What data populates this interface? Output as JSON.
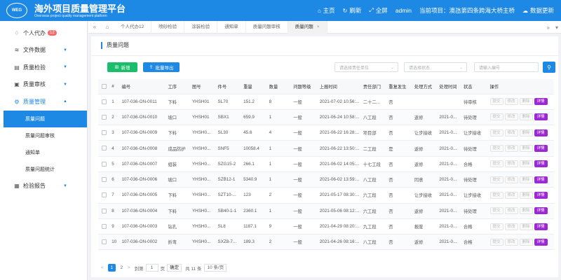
{
  "header": {
    "logo_text": "WEG",
    "title": "海外项目质量管理平台",
    "subtitle": "Overseas project quality management platform",
    "nav": [
      {
        "icon": "home-icon",
        "glyph": "⌂",
        "label": "主页"
      },
      {
        "icon": "refresh-icon",
        "glyph": "↻",
        "label": "刷新"
      },
      {
        "icon": "fullscreen-icon",
        "glyph": "⤢",
        "label": "全屏"
      },
      {
        "icon": "",
        "glyph": "",
        "label": "admin"
      },
      {
        "icon": "",
        "glyph": "",
        "label": "当前项目：澳氹第四条跨海大桥主桥"
      },
      {
        "icon": "cloud-update-icon",
        "glyph": "☁",
        "label": "数据更新"
      }
    ]
  },
  "sidebar": {
    "items": [
      {
        "label": "个人代办",
        "badge": "12"
      },
      {
        "label": "文件数据"
      },
      {
        "label": "质量检验"
      },
      {
        "label": "质量审核"
      },
      {
        "label": "质量管理"
      },
      {
        "label": "检验报告"
      }
    ],
    "sub_items": [
      "质量问题",
      "质量问题审核",
      "通知单",
      "质量问题统计"
    ]
  },
  "tabs": {
    "items": [
      "个人代办12",
      "喷砂检验",
      "涂装检验",
      "通知单",
      "质量问题审核",
      "质量问题"
    ]
  },
  "page": {
    "title": "质量问题",
    "add_label": "新增",
    "export_label": "批量导出",
    "filter_unit_placeholder": "请选择责任单位",
    "filter_status_placeholder": "请选择状态",
    "filter_code_placeholder": "请输入编号"
  },
  "table": {
    "columns": [
      "",
      "#",
      "编号",
      "工序",
      "图号",
      "件号",
      "重量",
      "数量",
      "问题等级",
      "上报时间",
      "责任部门",
      "重复发生",
      "处理方式",
      "处理时间",
      "状态",
      "操作"
    ],
    "op_labels": {
      "submit": "提交",
      "edit": "修改",
      "delete": "删除",
      "detail": "详情"
    },
    "rows": [
      {
        "no": "1",
        "code": "107-036-ON-0011",
        "process": "下料",
        "drawing": "YHSH01",
        "part": "SL70",
        "weight": "151.2",
        "qty": "8",
        "level": "一般",
        "time": "2021-07-02 10:56:...",
        "dept": "二十二...",
        "repeat": "否",
        "method": "",
        "handle_time": "",
        "status": "待审核",
        "status_class": "st-red"
      },
      {
        "no": "2",
        "code": "107-036-ON-0010",
        "process": "坡口",
        "drawing": "YHSH01",
        "part": "SBX1",
        "weight": "659.9",
        "qty": "1",
        "level": "一般",
        "time": "2021-06-24 10:58:...",
        "dept": "八工段",
        "repeat": "否",
        "method": "返修",
        "handle_time": "2021-0...",
        "status": "待处理",
        "status_class": "st-red"
      },
      {
        "no": "3",
        "code": "107-036-ON-0009",
        "process": "下料",
        "drawing": "YHSH0...",
        "part": "SL30",
        "weight": "45.6",
        "qty": "4",
        "level": "一般",
        "time": "2021-06-22 16:28:...",
        "dept": "项目部",
        "repeat": "否",
        "method": "让步接收",
        "handle_time": "2021-0...",
        "status": "让步接收",
        "status_class": "st-red"
      },
      {
        "no": "4",
        "code": "107-036-ON-0008",
        "process": "成品防护",
        "drawing": "YHSH0...",
        "part": "SNF5",
        "weight": "10058.4",
        "qty": "1",
        "level": "一般",
        "time": "2021-06-22 13:50:...",
        "dept": "二工段",
        "repeat": "是",
        "method": "返修",
        "handle_time": "2021-0...",
        "status": "待处理",
        "status_class": "st-red"
      },
      {
        "no": "5",
        "code": "107-036-ON-0007",
        "process": "组装",
        "drawing": "YHSH0...",
        "part": "SZG15-2",
        "weight": "266.1",
        "qty": "1",
        "level": "一般",
        "time": "2021-06-02 14:05:...",
        "dept": "十七工段",
        "repeat": "否",
        "method": "返修",
        "handle_time": "2021-0...",
        "status": "合格",
        "status_class": "st-green"
      },
      {
        "no": "6",
        "code": "107-036-ON-0006",
        "process": "坡口",
        "drawing": "YHSH0...",
        "part": "SZB12-1",
        "weight": "5340.9",
        "qty": "1",
        "level": "一般",
        "time": "2021-06-02 13:59:...",
        "dept": "八工段",
        "repeat": "否",
        "method": "同意",
        "handle_time": "2021-0...",
        "status": "待处理",
        "status_class": "st-red"
      },
      {
        "no": "7",
        "code": "107-036-ON-0005",
        "process": "下料",
        "drawing": "YHSH0...",
        "part": "SZT10-...",
        "weight": "123",
        "qty": "2",
        "level": "一般",
        "time": "2021-05-17 08:30:...",
        "dept": "六工段",
        "repeat": "否",
        "method": "让步接收",
        "handle_time": "2021-0...",
        "status": "让步接收",
        "status_class": "st-red"
      },
      {
        "no": "8",
        "code": "107-036-ON-0004",
        "process": "下料",
        "drawing": "YHSH0...",
        "part": "SB40-1-1",
        "weight": "2360.1",
        "qty": "1",
        "level": "一般",
        "time": "2021-05-06 08:12:...",
        "dept": "六工段",
        "repeat": "否",
        "method": "返修",
        "handle_time": "2021-0...",
        "status": "待处理",
        "status_class": "st-red"
      },
      {
        "no": "9",
        "code": "107-036-ON-0003",
        "process": "钻孔",
        "drawing": "YHSH0...",
        "part": "SL8",
        "weight": "1187.1",
        "qty": "9",
        "level": "一般",
        "time": "2021-04-29 08:20:...",
        "dept": "九工段",
        "repeat": "否",
        "method": "报废",
        "handle_time": "2021-0...",
        "status": "合格",
        "status_class": "st-green"
      },
      {
        "no": "10",
        "code": "107-036-ON-0002",
        "process": "折弯",
        "drawing": "YHSH0...",
        "part": "SXZ8-7...",
        "weight": "189.3",
        "qty": "2",
        "level": "一般",
        "time": "2021-04-26 08:16:...",
        "dept": "八工段",
        "repeat": "否",
        "method": "返修",
        "handle_time": "2021-0...",
        "status": "合格",
        "status_class": "st-green"
      }
    ]
  },
  "pager": {
    "prev": "<",
    "pages": [
      "1",
      "2"
    ],
    "next": ">",
    "goto_label": "到第",
    "current_input": "1",
    "page_unit": "页",
    "confirm_label": "确定",
    "total_label": "共 11 条",
    "page_size": "10 条/页"
  }
}
